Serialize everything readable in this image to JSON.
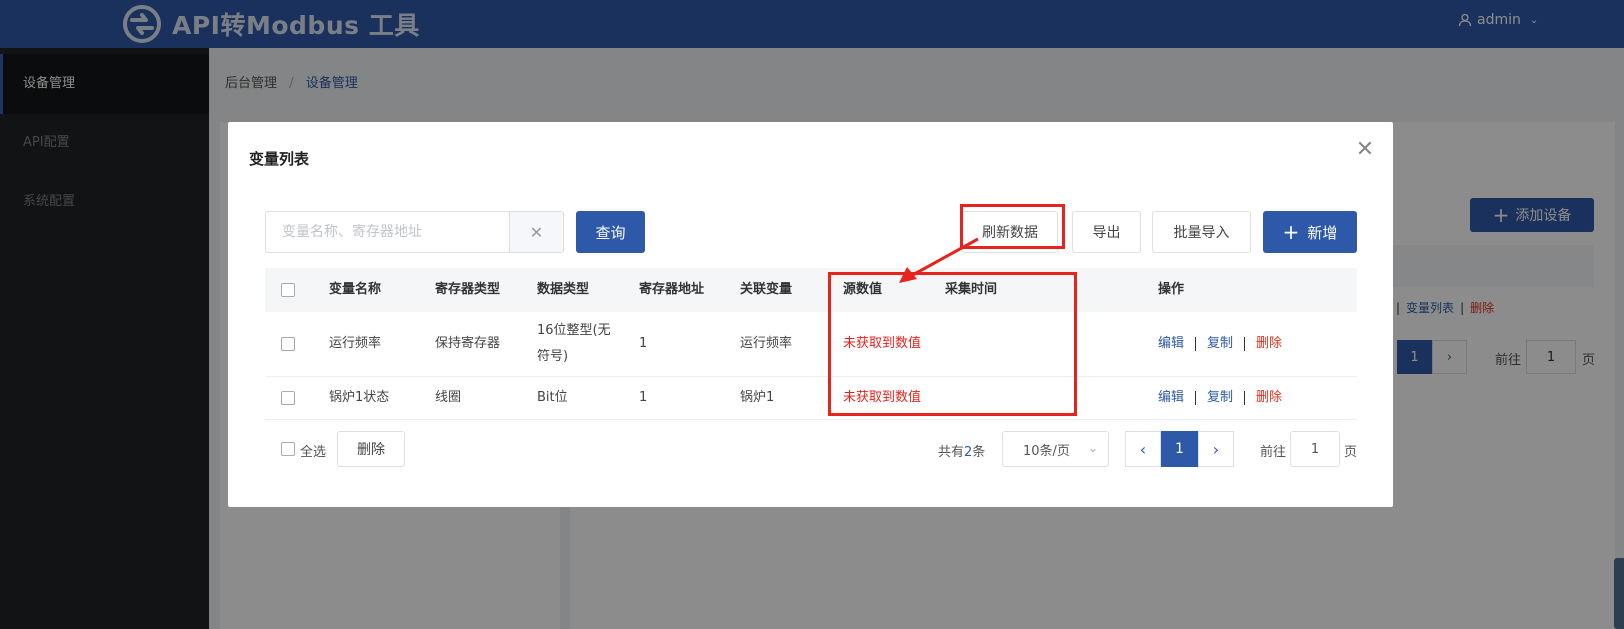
{
  "header": {
    "app_title": "API转Modbus 工具",
    "user_name": "admin"
  },
  "sidebar": {
    "items": [
      {
        "label": "设备管理",
        "active": true
      },
      {
        "label": "API配置",
        "active": false
      },
      {
        "label": "系统配置",
        "active": false
      }
    ]
  },
  "breadcrumb": {
    "root": "后台管理",
    "separator": "/",
    "current": "设备管理"
  },
  "background_page": {
    "add_device_label": "添加设备",
    "row_ops": [
      "变量列表",
      "删除"
    ],
    "page_current": "1",
    "goto_label": "前往",
    "goto_value": "1",
    "goto_unit": "页"
  },
  "dialog": {
    "title": "变量列表",
    "search": {
      "placeholder": "变量名称、寄存器地址",
      "value": ""
    },
    "buttons": {
      "query": "查询",
      "refresh": "刷新数据",
      "export": "导出",
      "batch_import": "批量导入",
      "add": "新增"
    },
    "table": {
      "columns": [
        "变量名称",
        "寄存器类型",
        "数据类型",
        "寄存器地址",
        "关联变量",
        "源数值",
        "采集时间",
        "操作"
      ],
      "rows": [
        {
          "name": "运行频率",
          "register_type": "保持寄存器",
          "data_type_line1": "16位整型(无",
          "data_type_line2": "符号)",
          "address": "1",
          "linked_var": "运行频率",
          "source_value": "未获取到数值",
          "collect_time": "",
          "ops": [
            "编辑",
            "复制",
            "删除"
          ]
        },
        {
          "name": "锅炉1状态",
          "register_type": "线圈",
          "data_type_line1": "Bit位",
          "data_type_line2": "",
          "address": "1",
          "linked_var": "锅炉1",
          "source_value": "未获取到数值",
          "collect_time": "",
          "ops": [
            "编辑",
            "复制",
            "删除"
          ]
        }
      ]
    },
    "footer": {
      "select_all": "全选",
      "delete": "删除",
      "total_prefix": "共有",
      "total_count": "2",
      "total_suffix": "条",
      "page_size": "10条/页",
      "current_page": "1",
      "goto_label": "前往",
      "goto_value": "1",
      "goto_unit": "页"
    }
  },
  "colors": {
    "primary": "#2e59a8",
    "header_bg": "#2e59a8",
    "sidebar_bg": "#202327",
    "danger": "#e0301e",
    "highlight": "#e8231e"
  }
}
